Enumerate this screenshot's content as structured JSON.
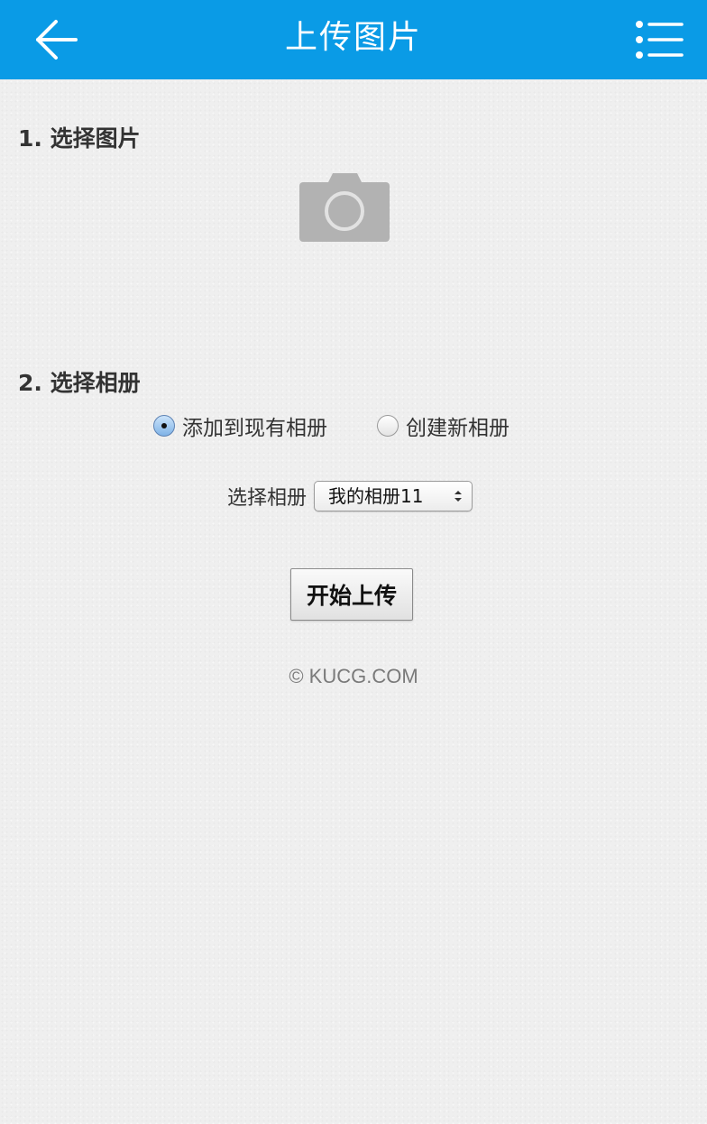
{
  "header": {
    "title": "上传图片",
    "back_icon": "arrow-left-icon",
    "menu_icon": "list-menu-icon",
    "bg_color": "#0a9be6"
  },
  "step1": {
    "label": "1. 选择图片",
    "picker_icon": "camera-icon"
  },
  "step2": {
    "label": "2. 选择相册",
    "radio_options": [
      {
        "label": "添加到现有相册",
        "checked": true
      },
      {
        "label": "创建新相册",
        "checked": false
      }
    ],
    "album_select_label": "选择相册",
    "album_selected": "我的相册11"
  },
  "upload_button": "开始上传",
  "footer": "© KUCG.COM"
}
